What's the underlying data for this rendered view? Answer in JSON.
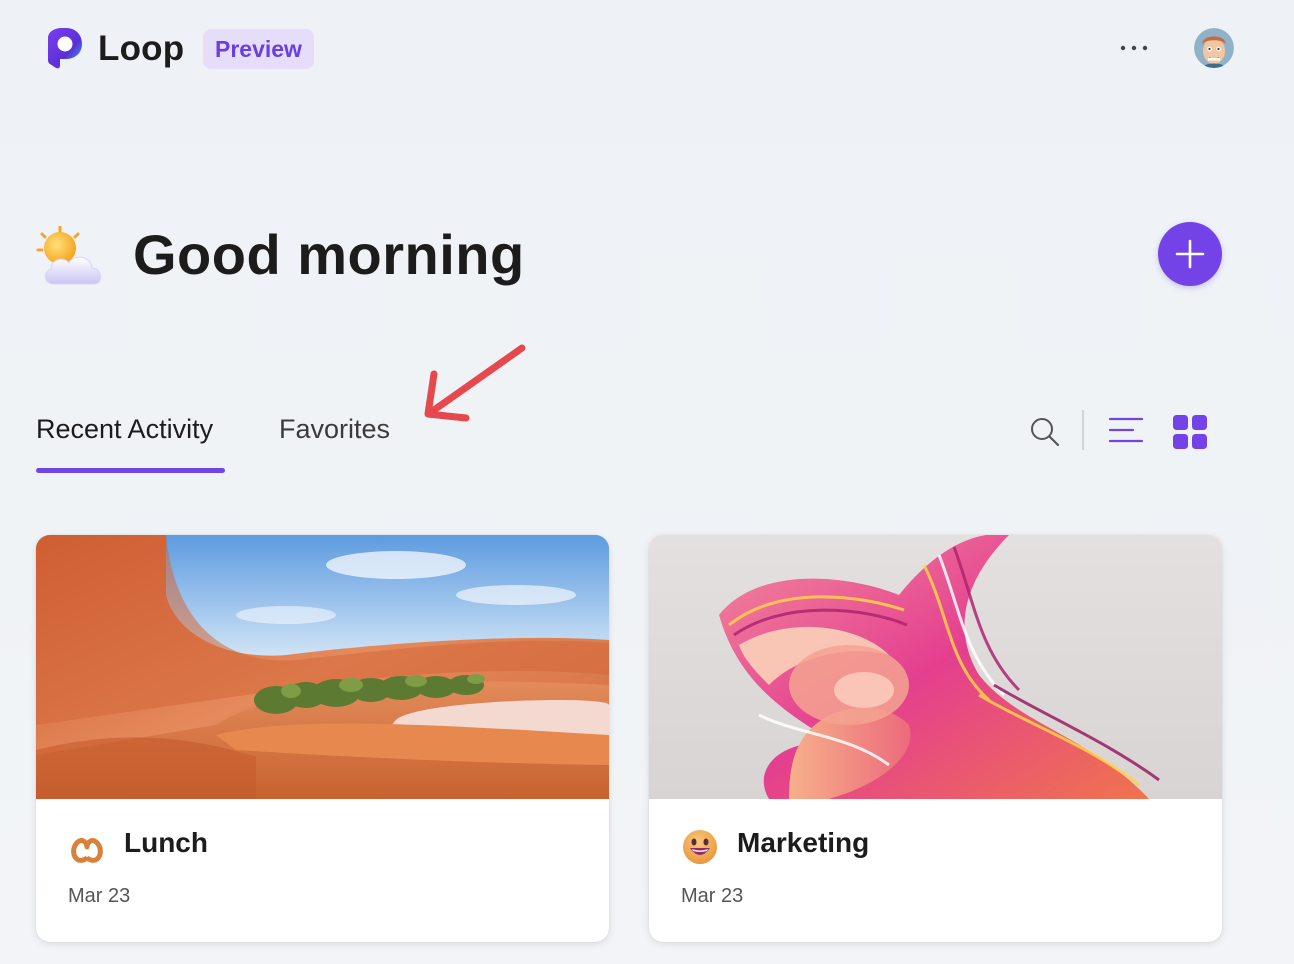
{
  "header": {
    "app_name": "Loop",
    "badge": "Preview",
    "more_icon": "more-horizontal-icon",
    "avatar_icon": "user-avatar"
  },
  "greeting": {
    "icon": "sun-behind-cloud-icon",
    "text": "Good morning",
    "new_button_icon": "plus-icon"
  },
  "tabs": [
    {
      "label": "Recent Activity",
      "selected": true
    },
    {
      "label": "Favorites",
      "selected": false
    }
  ],
  "toolbar": {
    "search_icon": "search-icon",
    "list_view_icon": "list-view-icon",
    "grid_view_icon": "grid-view-icon",
    "active_view": "grid"
  },
  "annotation": {
    "icon": "red-arrow-icon",
    "color": "#e5484d"
  },
  "cards": [
    {
      "title": "Lunch",
      "date": "Mar 23",
      "emoji": "pretzel-icon",
      "image": "desert-architecture-image"
    },
    {
      "title": "Marketing",
      "date": "Mar 23",
      "emoji": "grinning-face-icon",
      "image": "abstract-swirl-image"
    }
  ],
  "colors": {
    "accent": "#7443e8",
    "badge_bg": "#e6ddfa",
    "badge_text": "#6a3fe0",
    "background": "#eef2f6"
  }
}
